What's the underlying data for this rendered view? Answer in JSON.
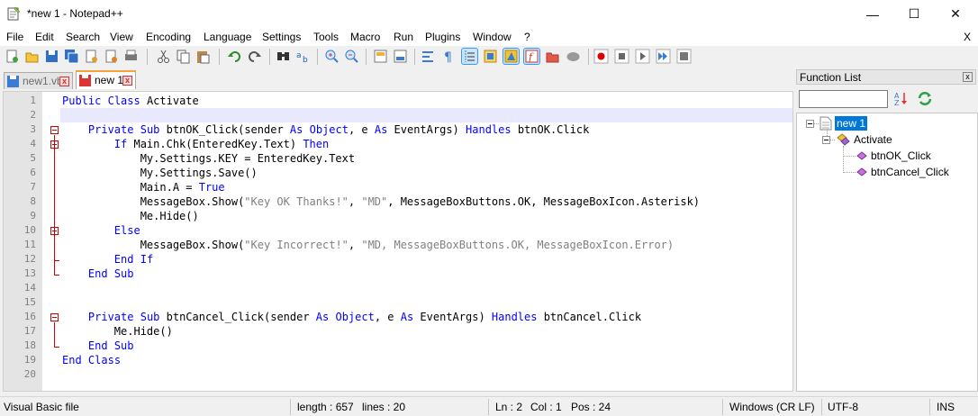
{
  "window": {
    "title": "*new 1 - Notepad++",
    "minimize": "—",
    "maximize": "☐",
    "close": "✕"
  },
  "menubar": {
    "items": [
      "File",
      "Edit",
      "Search",
      "View",
      "Encoding",
      "Language",
      "Settings",
      "Tools",
      "Macro",
      "Run",
      "Plugins",
      "Window",
      "?"
    ],
    "close_doc": "X"
  },
  "tabs": [
    {
      "label": "new1.vb",
      "active": false
    },
    {
      "label": "new 1",
      "active": true
    }
  ],
  "editor": {
    "current_line": 2,
    "lines": [
      "Public Class Activate",
      "",
      "    Private Sub btnOK_Click(sender As Object, e As EventArgs) Handles btnOK.Click",
      "        If Main.Chk(EnteredKey.Text) Then",
      "            My.Settings.KEY = EnteredKey.Text",
      "            My.Settings.Save()",
      "            Main.A = True",
      "            MessageBox.Show(\"Key OK Thanks!\", \"MD\", MessageBoxButtons.OK, MessageBoxIcon.Asterisk)",
      "            Me.Hide()",
      "        Else",
      "            MessageBox.Show(\"Key Incorrect!\", \"MD, MessageBoxButtons.OK, MessageBoxIcon.Error)",
      "        End If",
      "    End Sub",
      "",
      "",
      "    Private Sub btnCancel_Click(sender As Object, e As EventArgs) Handles btnCancel.Click",
      "        Me.Hide()",
      "    End Sub",
      "End Class",
      ""
    ]
  },
  "function_list": {
    "title": "Function List",
    "close": "x",
    "search_value": "",
    "tree": {
      "root": "new 1",
      "class": "Activate",
      "functions": [
        "btnOK_Click",
        "btnCancel_Click"
      ]
    }
  },
  "statusbar": {
    "file_type": "Visual Basic file",
    "length": "length : 657",
    "lines": "lines : 20",
    "ln": "Ln : 2",
    "col": "Col : 1",
    "pos": "Pos : 24",
    "eol": "Windows (CR LF)",
    "encoding": "UTF-8",
    "mode": "INS"
  },
  "colors": {
    "keyword": "#0000ff",
    "string": "#808080",
    "fold_marker": "#cc0000",
    "active_tab_accent": "#f6a33b",
    "selection": "#0078d7"
  }
}
